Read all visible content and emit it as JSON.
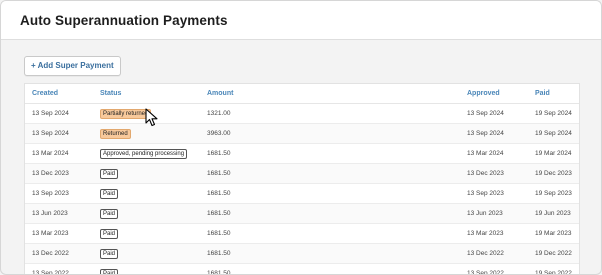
{
  "header": {
    "title": "Auto Superannuation Payments"
  },
  "toolbar": {
    "add_label": "+ Add Super Payment"
  },
  "table": {
    "columns": {
      "created": "Created",
      "status": "Status",
      "amount": "Amount",
      "approved": "Approved",
      "paid": "Paid"
    },
    "rows": [
      {
        "created": "13 Sep 2024",
        "status": "Partially returned",
        "status_type": "partial",
        "amount": "1321.00",
        "approved": "13 Sep 2024",
        "paid": "19 Sep 2024"
      },
      {
        "created": "13 Sep 2024",
        "status": "Returned",
        "status_type": "returned",
        "amount": "3963.00",
        "approved": "13 Sep 2024",
        "paid": "19 Sep 2024"
      },
      {
        "created": "13 Mar 2024",
        "status": "Approved, pending processing",
        "status_type": "outline",
        "amount": "1681.50",
        "approved": "13 Mar 2024",
        "paid": "19 Mar 2024"
      },
      {
        "created": "13 Dec 2023",
        "status": "Paid",
        "status_type": "outline",
        "amount": "1681.50",
        "approved": "13 Dec 2023",
        "paid": "19 Dec 2023"
      },
      {
        "created": "13 Sep 2023",
        "status": "Paid",
        "status_type": "outline",
        "amount": "1681.50",
        "approved": "13 Sep 2023",
        "paid": "19 Sep 2023"
      },
      {
        "created": "13 Jun 2023",
        "status": "Paid",
        "status_type": "outline",
        "amount": "1681.50",
        "approved": "13 Jun 2023",
        "paid": "19 Jun 2023"
      },
      {
        "created": "13 Mar 2023",
        "status": "Paid",
        "status_type": "outline",
        "amount": "1681.50",
        "approved": "13 Mar 2023",
        "paid": "19 Mar 2023"
      },
      {
        "created": "13 Dec 2022",
        "status": "Paid",
        "status_type": "outline",
        "amount": "1681.50",
        "approved": "13 Dec 2022",
        "paid": "19 Dec 2022"
      },
      {
        "created": "13 Sep 2022",
        "status": "Paid",
        "status_type": "outline",
        "amount": "1681.50",
        "approved": "13 Sep 2022",
        "paid": "19 Sep 2022"
      }
    ]
  },
  "colors": {
    "link_blue": "#4a86b8",
    "badge_orange": "#f8c99b"
  },
  "cursor": {
    "icon": "mouse-pointer-icon"
  }
}
